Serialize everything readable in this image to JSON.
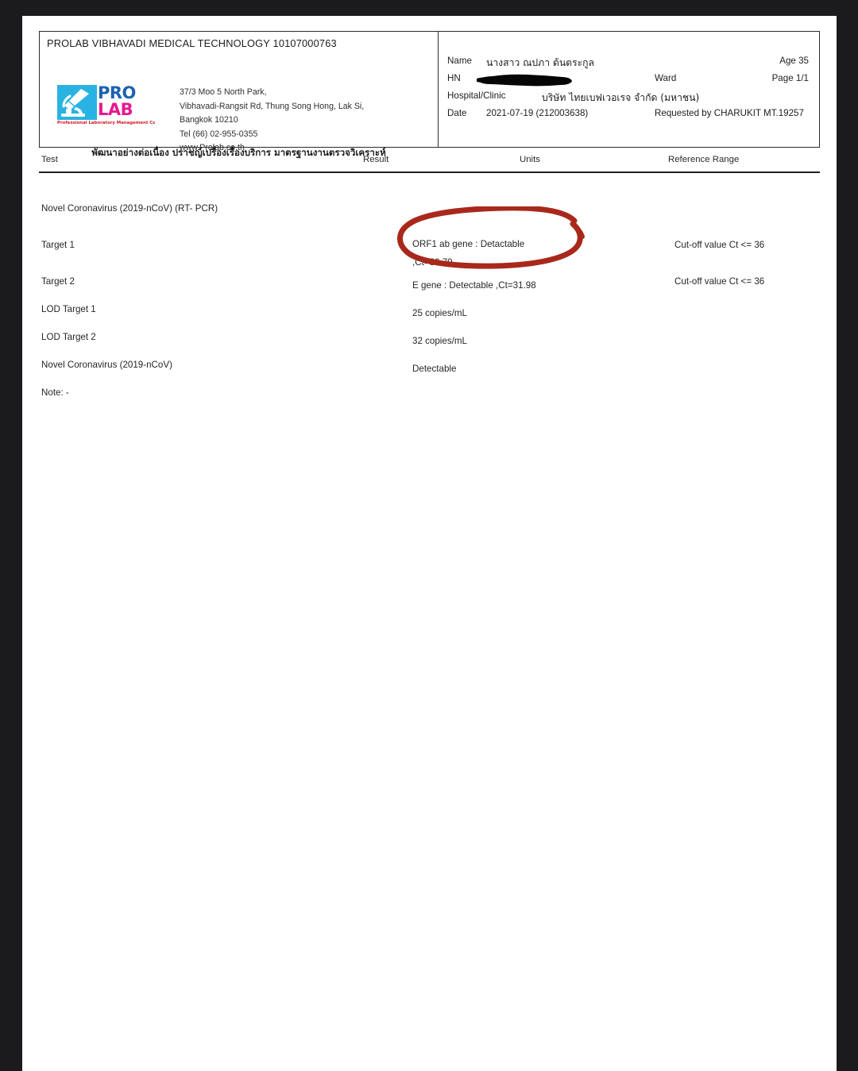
{
  "document": {
    "type": "medical-lab-report",
    "lab_title": "PROLAB VIBHAVADI MEDICAL TECHNOLOGY 10107000763",
    "logo": {
      "word_top": "PRO",
      "word_bottom": "LAB",
      "tagline": "Professional Laboratory Management Corp. Co.,Ltd.",
      "color_box": "#29b3e3",
      "color_pro": "#1b63b0",
      "color_lab": "#e8188f",
      "color_tagline": "#d41a24"
    },
    "address": [
      "37/3 Moo 5 North Park,",
      "Vibhavadi-Rangsit Rd, Thung Song Hong, Lak Si,",
      "Bangkok 10210",
      "Tel (66) 02-955-0355",
      "www.Prolab.co.th"
    ],
    "thai_slogan": "พัฒนาอย่างต่อเนื่อง ปราชญ์เปรื่องเรื่องบริการ มาตรฐานงานตรวจวิเคราะห์"
  },
  "patient": {
    "name_label": "Name",
    "name_value": "นางสาว ณปภา ต้นตระกูล",
    "age_label": "Age 35",
    "hn_label": "HN",
    "hn_value": "",
    "hn_redacted": true,
    "ward_label": "Ward",
    "ward_value": "",
    "page_label": "Page 1/1",
    "hospital_label": "Hospital/Clinic",
    "hospital_value": "บริษัท ไทยเบฟเวอเรจ จำกัด (มหาชน)",
    "date_label": "Date",
    "date_value": "2021-07-19 (212003638)",
    "requested_by": "Requested by CHARUKIT MT.19257"
  },
  "table": {
    "columns": [
      "Test",
      "Result",
      "Units",
      "Reference Range"
    ],
    "rows": [
      {
        "test": "Novel Coronavirus (2019-nCoV) (RT- PCR)",
        "result": "",
        "units": "",
        "reference": ""
      },
      {
        "test": "Target 1",
        "result": "ORF1 ab gene : Detactable\n,Ct=30.79",
        "units": "",
        "reference": "Cut-off value Ct <= 36"
      },
      {
        "test": "Target 2",
        "result": "E gene : Detectable ,Ct=31.98",
        "units": "",
        "reference": "Cut-off value Ct <= 36"
      },
      {
        "test": "LOD Target 1",
        "result": "25 copies/mL",
        "units": "",
        "reference": ""
      },
      {
        "test": "LOD Target 2",
        "result": "32 copies/mL",
        "units": "",
        "reference": ""
      },
      {
        "test": "Novel Coronavirus (2019-nCoV)",
        "result": "Detectable",
        "units": "",
        "reference": ""
      },
      {
        "test": "Note: -",
        "result": "",
        "units": "",
        "reference": ""
      }
    ]
  },
  "annotations": {
    "circle": {
      "name": "hand-drawn-red-circle",
      "color": "#a8291c",
      "targets": "Target 1 result"
    },
    "redaction": {
      "name": "hn-black-marker-redaction",
      "color": "#000000"
    }
  }
}
